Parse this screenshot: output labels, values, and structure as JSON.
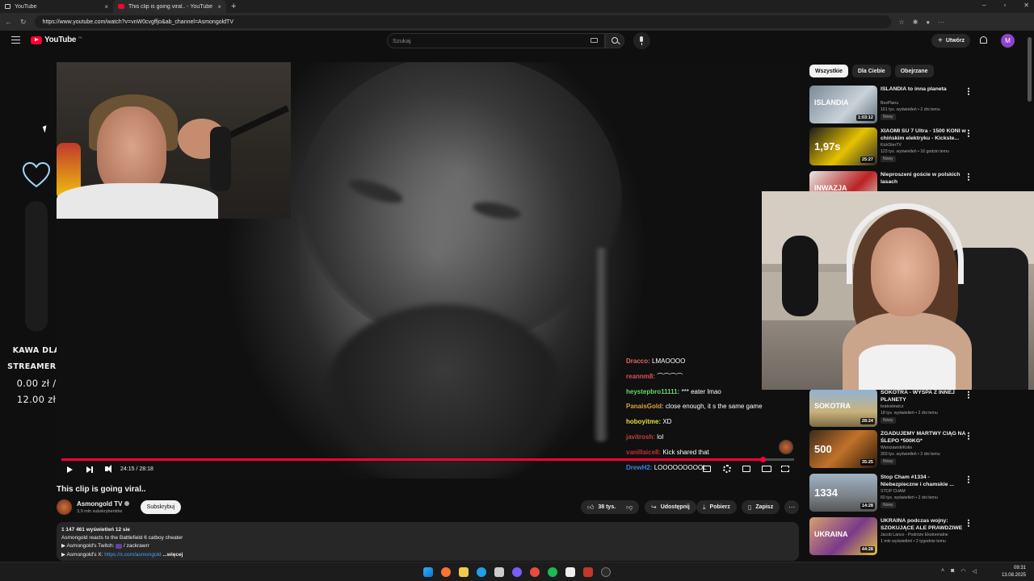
{
  "browser": {
    "tabs": [
      {
        "label": "YouTube"
      },
      {
        "label": "This clip is going viral.. - YouTube"
      }
    ],
    "url": "https://www.youtube.com/watch?v=vnW0cvgffjo&ab_channel=AsmongoldTV"
  },
  "header": {
    "logo": "YouTube",
    "country": "PL",
    "search_placeholder": "Szukaj",
    "create_label": "Utwórz",
    "avatar_letter": "M"
  },
  "overlay": {
    "line1": "KAWA DLA",
    "line2": "STREAMERKI",
    "amount_current": "0.00 zł /",
    "amount_goal": "12.00 zł"
  },
  "chat": [
    {
      "user": "Dracco:",
      "text": "LMAOOOO",
      "color": "#e06666"
    },
    {
      "user": "reannm8:",
      "text": "⌒⌒⌒⌒",
      "color": "#e05050"
    },
    {
      "user": "heystepbro11111:",
      "text": "*** eater lmao",
      "color": "#6bd46b"
    },
    {
      "user": "PanaisGold:",
      "text": "close enough, it s the same game",
      "color": "#e0a040"
    },
    {
      "user": "hoboyitme:",
      "text": "XD",
      "color": "#e0e040"
    },
    {
      "user": "javitrosh:",
      "text": "lol",
      "color": "#c04040"
    },
    {
      "user": "vanillaice8:",
      "text": "Kick shared that",
      "color": "#c03030"
    },
    {
      "user": "DrewH2:",
      "text": "LOOOOOOOOOL",
      "color": "#4080e0"
    }
  ],
  "player": {
    "time": "24:15 / 28:18",
    "progress": 0.957
  },
  "video": {
    "title": "This clip is going viral..",
    "channel": "Asmongold TV",
    "subscribers": "3,9 mln subskrybentów",
    "subscribe_label": "Subskrybuj",
    "likes": "38 tys.",
    "share_label": "Udostępnij",
    "download_label": "Pobierz",
    "save_label": "Zapisz",
    "views_age": "1 147 461 wyświetleń  12 sie",
    "desc_line1": "Asmongold reacts to the Battlefield 6 catboy cheater",
    "desc_line2_prefix": "▶ Asmongold's Twitch: ",
    "desc_line2_link": "/ zackrawrr",
    "desc_line3_prefix": "▶ Asmongold's X: ",
    "desc_line3_link": "https://x.com/asmongold",
    "more_label": "...więcej"
  },
  "filters": [
    "Wszystkie",
    "Dla Ciebie",
    "Obejrzane"
  ],
  "recommendations": [
    {
      "title": "ISLANDIA to inna planeta",
      "channel": "BezPlanu",
      "views": "161 tys. wyświetleń • 2 dni temu",
      "badge": "Nowy",
      "duration": "1:03:12",
      "thumb_text": "ISLANDIA",
      "bg": "linear-gradient(135deg,#7a8a96,#c9d2d8 60%,#5f6e78)"
    },
    {
      "title": "XIAOMI SU 7 Ultra - 1500 KONI w chińskim elektryku - Kickste...",
      "channel": "KickSterTV",
      "views": "123 tys. wyświetleń • 16 godzin temu",
      "badge": "Nowy",
      "duration": "25:27",
      "thumb_text": "1,97s",
      "bg": "linear-gradient(135deg,#1a1a1a,#e6c200 55%,#2a2a2a)"
    },
    {
      "title": "Nieproszeni goście w polskich lasach",
      "channel": "",
      "views": "",
      "badge": "",
      "duration": "",
      "thumb_text": "INWAZJA",
      "bg": "linear-gradient(135deg,#e8e8e8,#b22 60%,#ddd)"
    },
    {
      "title": "SOKOTRA - WYSPA Z INNEJ PLANETY",
      "channel": "bratoslewicz",
      "views": "18 tys. wyświetleń • 2 dni temu",
      "badge": "Nowy",
      "duration": "28:24",
      "thumb_text": "SOKOTRA",
      "bg": "linear-gradient(180deg,#8fb3d8,#c9b27c 60%,#7b6a44)"
    },
    {
      "title": "ZGADUJEMY MARTWY CIĄG NA ŚLEPO *500KG*",
      "channel": "WarszawskiKoks",
      "views": "303 tys. wyświetleń • 2 dni temu",
      "badge": "Nowy",
      "duration": "35:25",
      "thumb_text": "500",
      "bg": "linear-gradient(135deg,#3a2a1a,#c2722a 50%,#2a1a0a)"
    },
    {
      "title": "Stop Cham #1334 - Niebezpieczne i chamskie ...",
      "channel": "STOP CHAM",
      "views": "60 tys. wyświetleń • 2 dni temu",
      "badge": "Nowy",
      "duration": "14:28",
      "thumb_text": "1334",
      "bg": "linear-gradient(180deg,#9eb2c4,#7b8288 60%,#555)"
    },
    {
      "title": "UKRAINA podczas wojny: SZOKUJĄCE ALE PRAWDZIWE",
      "channel": "Jacob Lanco - Podróże Ekstremalne",
      "views": "1 mln wyświetleń • 2 tygodnie temu",
      "badge": "",
      "duration": "44:28",
      "thumb_text": "UKRAINA",
      "bg": "linear-gradient(135deg,#d8a070,#7a3a8a 55%,#e0c040)"
    }
  ],
  "taskbar": {
    "time": "09:31",
    "date": "13.08.2025"
  }
}
